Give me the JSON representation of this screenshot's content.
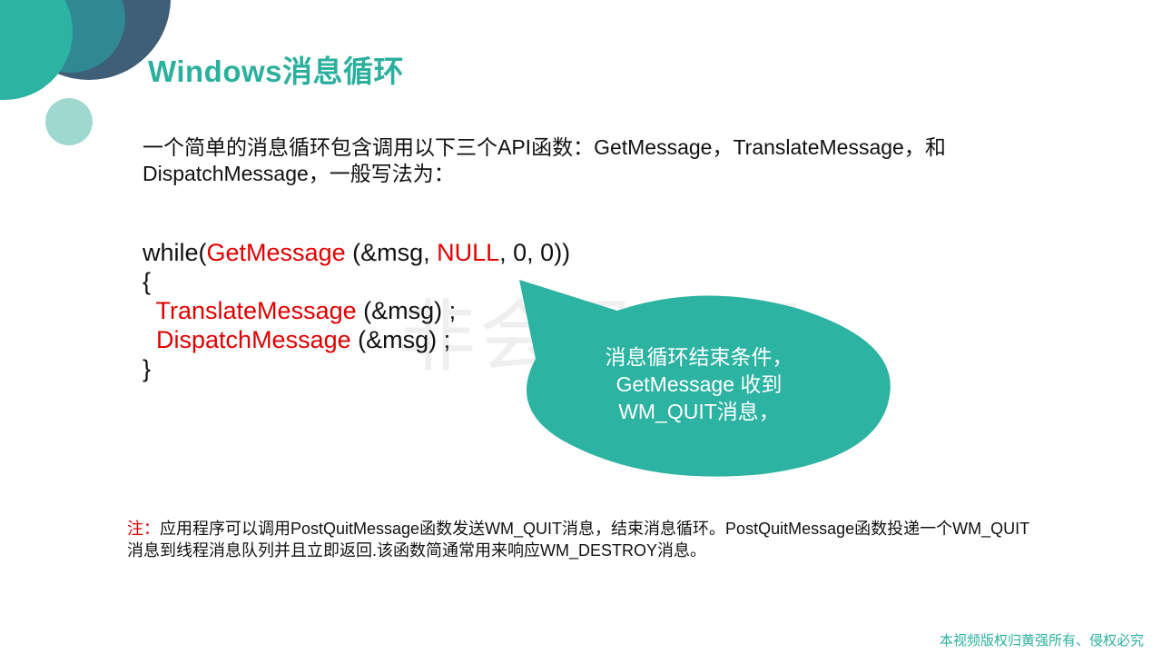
{
  "title": "Windows消息循环",
  "intro": "一个简单的消息循环包含调用以下三个API函数：GetMessage，TranslateMessage，和DispatchMessage，一般写法为：",
  "code": {
    "l1_kw": "while(",
    "l1_fn": "GetMessage",
    "l1_a": " (&msg, ",
    "l1_null": "NULL",
    "l1_b": ", 0, 0))",
    "l2": "{",
    "l3_fn": "TranslateMessage",
    "l3_rest": " (&msg) ;",
    "l4_fn": "DispatchMessage",
    "l4_rest": " (&msg) ;",
    "l5": "}"
  },
  "watermark": "非会员水印",
  "bubble": {
    "line1": "消息循环结束条件，",
    "line2": "GetMessage 收到",
    "line3": "WM_QUIT消息，",
    "color": "#2cb3a2"
  },
  "note": {
    "prefix": "注：",
    "text": "应用程序可以调用PostQuitMessage函数发送WM_QUIT消息，结束消息循环。PostQuitMessage函数投递一个WM_QUIT消息到线程消息队列并且立即返回.该函数简通常用来响应WM_DESTROY消息。"
  },
  "copyright": "本视频版权归黄强所有、侵权必究",
  "colors": {
    "accent": "#2cb09e",
    "code_red": "#e00000",
    "deco_dark": "#3e5f77"
  }
}
